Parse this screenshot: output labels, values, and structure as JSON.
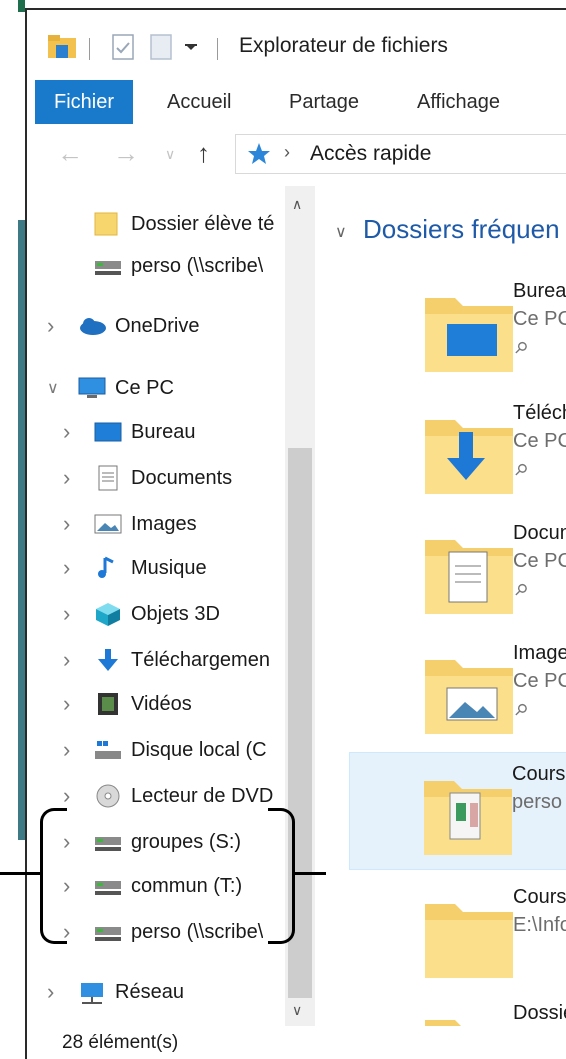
{
  "window": {
    "title": "Explorateur de fichiers"
  },
  "ribbon": {
    "tabs": [
      "Fichier",
      "Accueil",
      "Partage",
      "Affichage"
    ]
  },
  "address": {
    "path": "Accès rapide"
  },
  "navpane": {
    "items": [
      {
        "label": "Dossier élève té",
        "icon": "folder-icon",
        "indent": 2
      },
      {
        "label": "perso (\\\\scribe\\",
        "icon": "network-drive-icon",
        "indent": 2
      },
      {
        "label": "OneDrive",
        "icon": "cloud-icon",
        "indent": 1,
        "chevron": "right"
      },
      {
        "label": "Ce PC",
        "icon": "computer-icon",
        "indent": 1,
        "chevron": "down"
      },
      {
        "label": "Bureau",
        "icon": "desktop-icon",
        "indent": 2,
        "chevron": "right"
      },
      {
        "label": "Documents",
        "icon": "documents-icon",
        "indent": 2,
        "chevron": "right"
      },
      {
        "label": "Images",
        "icon": "images-icon",
        "indent": 2,
        "chevron": "right"
      },
      {
        "label": "Musique",
        "icon": "music-icon",
        "indent": 2,
        "chevron": "right"
      },
      {
        "label": "Objets 3D",
        "icon": "cube-icon",
        "indent": 2,
        "chevron": "right"
      },
      {
        "label": "Téléchargemen",
        "icon": "download-icon",
        "indent": 2,
        "chevron": "right"
      },
      {
        "label": "Vidéos",
        "icon": "video-icon",
        "indent": 2,
        "chevron": "right"
      },
      {
        "label": "Disque local (C",
        "icon": "local-disk-icon",
        "indent": 2,
        "chevron": "right"
      },
      {
        "label": "Lecteur de DVD",
        "icon": "dvd-icon",
        "indent": 2,
        "chevron": "right"
      },
      {
        "label": "groupes (S:)",
        "icon": "network-drive-icon",
        "indent": 2,
        "chevron": "right"
      },
      {
        "label": "commun (T:)",
        "icon": "network-drive-icon",
        "indent": 2,
        "chevron": "right"
      },
      {
        "label": "perso (\\\\scribe\\",
        "icon": "network-drive-icon",
        "indent": 2,
        "chevron": "right"
      },
      {
        "label": "Réseau",
        "icon": "network-icon",
        "indent": 1,
        "chevron": "right"
      }
    ]
  },
  "content": {
    "section_title": "Dossiers fréquen",
    "tiles": [
      {
        "name": "Bureau",
        "sub": "Ce PC"
      },
      {
        "name": "Téléchar",
        "sub": "Ce PC"
      },
      {
        "name": "Docume",
        "sub": "Ce PC"
      },
      {
        "name": "Images",
        "sub": "Ce PC"
      },
      {
        "name": "Cours in",
        "sub": "perso (\\"
      },
      {
        "name": "Cours in",
        "sub": "E:\\Inforr"
      },
      {
        "name": "Dossier é",
        "sub": ""
      }
    ]
  },
  "status": {
    "count": "28 élément(s)"
  },
  "colors": {
    "accent": "#1979ca",
    "folder": "#f5cf6b",
    "section": "#1e5aa8"
  }
}
